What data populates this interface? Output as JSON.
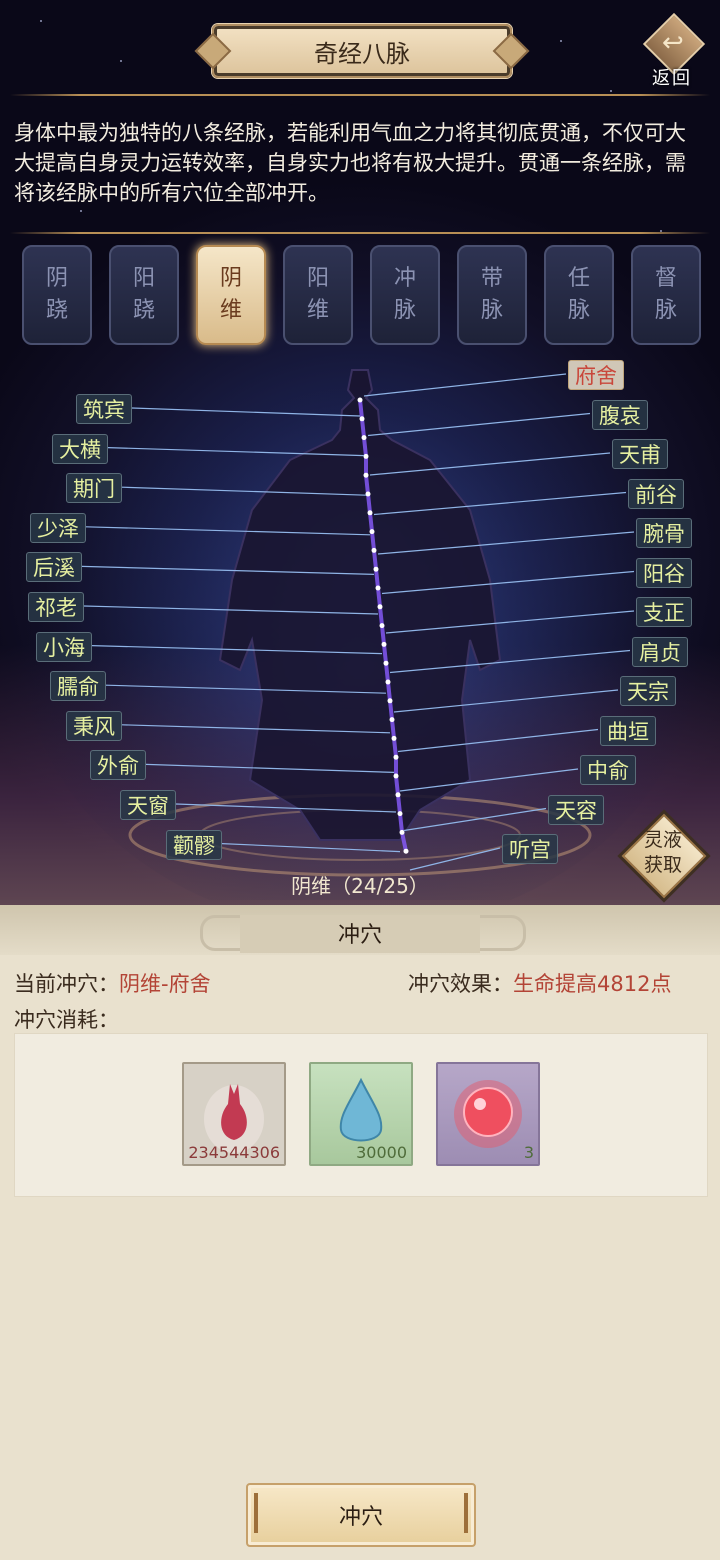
{
  "header": {
    "title": "奇经八脉",
    "back_label": "返回",
    "description": "身体中最为独特的八条经脉，若能利用气血之力将其彻底贯通，不仅可大大提高自身灵力运转效率，自身实力也将有极大提升。贯通一条经脉，需将该经脉中的所有穴位全部冲开。"
  },
  "tabs": [
    {
      "top": "阴",
      "bottom": "跷"
    },
    {
      "top": "阳",
      "bottom": "跷"
    },
    {
      "top": "阴",
      "bottom": "维"
    },
    {
      "top": "阳",
      "bottom": "维"
    },
    {
      "top": "冲",
      "bottom": "脉"
    },
    {
      "top": "带",
      "bottom": "脉"
    },
    {
      "top": "任",
      "bottom": "脉"
    },
    {
      "top": "督",
      "bottom": "脉"
    }
  ],
  "active_tab": 2,
  "acupoints_left": [
    "筑宾",
    "大横",
    "期门",
    "少泽",
    "后溪",
    "祁老",
    "小海",
    "臑俞",
    "秉风",
    "外俞",
    "天窗",
    "颧髎"
  ],
  "acupoints_right": [
    "府舍",
    "腹哀",
    "天甫",
    "前谷",
    "腕骨",
    "阳谷",
    "支正",
    "肩贞",
    "天宗",
    "曲垣",
    "中俞",
    "天容",
    "听宫"
  ],
  "current_point_index": 0,
  "progress": {
    "label": "阴维（24/25）",
    "opened": 24,
    "total": 25
  },
  "liquid_button": {
    "line1": "灵液",
    "line2": "获取"
  },
  "panel": {
    "title": "冲穴",
    "current_label": "当前冲穴：",
    "current_value": "阴维-府舍",
    "effect_label": "冲穴效果：",
    "effect_value": "生命提高4812点",
    "cost_label": "冲穴消耗："
  },
  "items": [
    {
      "name": "red-drop",
      "count": "234544306"
    },
    {
      "name": "blue-drop",
      "count": "30000"
    },
    {
      "name": "red-orb",
      "count": "3"
    }
  ],
  "action_button": "冲穴",
  "colors": {
    "accent": "#d9bb8a",
    "current_point": "#c9473b",
    "label_text": "#e6f0a0",
    "meridian": "#8a5cff"
  }
}
